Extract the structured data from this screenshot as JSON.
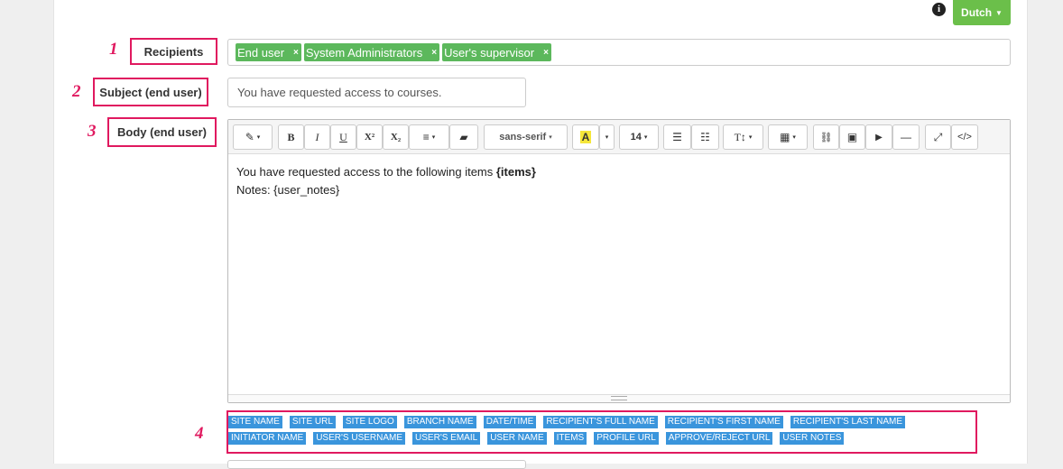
{
  "header": {
    "language_label": "Dutch",
    "info_glyph": "i"
  },
  "annotations": [
    "1",
    "2",
    "3",
    "4"
  ],
  "recipients": {
    "label": "Recipients",
    "tags": [
      "End user",
      "System Administrators",
      "User's supervisor"
    ],
    "remove_glyph": "×"
  },
  "subject": {
    "label": "Subject (end user)",
    "value": "You have requested access to courses."
  },
  "body": {
    "label": "Body (end user)",
    "line1_text": "You have requested access to the following items ",
    "line1_bold": "{items}",
    "line2": "Notes: {user_notes}"
  },
  "toolbar": {
    "magic_icon": "✎",
    "bold": "B",
    "italic": "I",
    "underline": "U",
    "superscript": "X²",
    "subscript": "X₂",
    "align_icon": "≡",
    "eraser_icon": "▰",
    "font_family": "sans-serif",
    "color_letter": "A",
    "font_size": "14",
    "ul_icon": "☰",
    "ol_icon": "☷",
    "line_height_icon": "T↕",
    "table_icon": "▦",
    "link_icon": "🔗",
    "image_icon": "▣",
    "video_icon": "▶",
    "hr_icon": "—",
    "fullscreen_icon": "⤢",
    "code_icon": "</>",
    "caret": "▾",
    "color_highlight": "#f5e63a"
  },
  "variables": [
    "SITE NAME",
    "SITE URL",
    "SITE LOGO",
    "BRANCH NAME",
    "DATE/TIME",
    "RECIPIENT'S FULL NAME",
    "RECIPIENT'S FIRST NAME",
    "RECIPIENT'S LAST NAME",
    "INITIATOR NAME",
    "USER'S USERNAME",
    "USER'S EMAIL",
    "USER NAME",
    "ITEMS",
    "PROFILE URL",
    "APPROVE/REJECT URL",
    "USER NOTES"
  ],
  "colors": {
    "accent_green": "#6bbf4a",
    "tag_green": "#5cb85c",
    "variable_blue": "#3a95dc",
    "annotation_red": "#e0195f"
  }
}
